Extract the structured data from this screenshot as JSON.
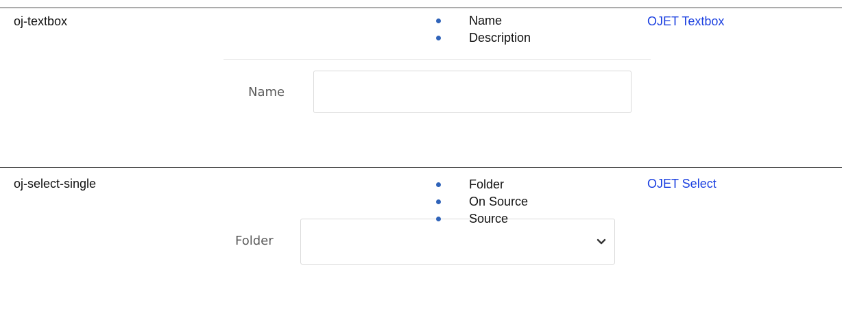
{
  "rows": [
    {
      "component": "oj-textbox",
      "properties": [
        "Name",
        "Description"
      ],
      "link_label": "OJET Textbox",
      "sample": {
        "label": "Name",
        "value": ""
      }
    },
    {
      "component": "oj-select-single",
      "properties": [
        "Folder",
        "On Source",
        "Source"
      ],
      "link_label": "OJET Select",
      "sample": {
        "label": "Folder",
        "value": ""
      }
    }
  ],
  "colors": {
    "link": "#1a3fe0",
    "bullet": "#2f63b9",
    "rule": "#444444",
    "field_border": "#d9d9d9"
  },
  "icons": {
    "select_toggle": "chevron-down-icon"
  }
}
